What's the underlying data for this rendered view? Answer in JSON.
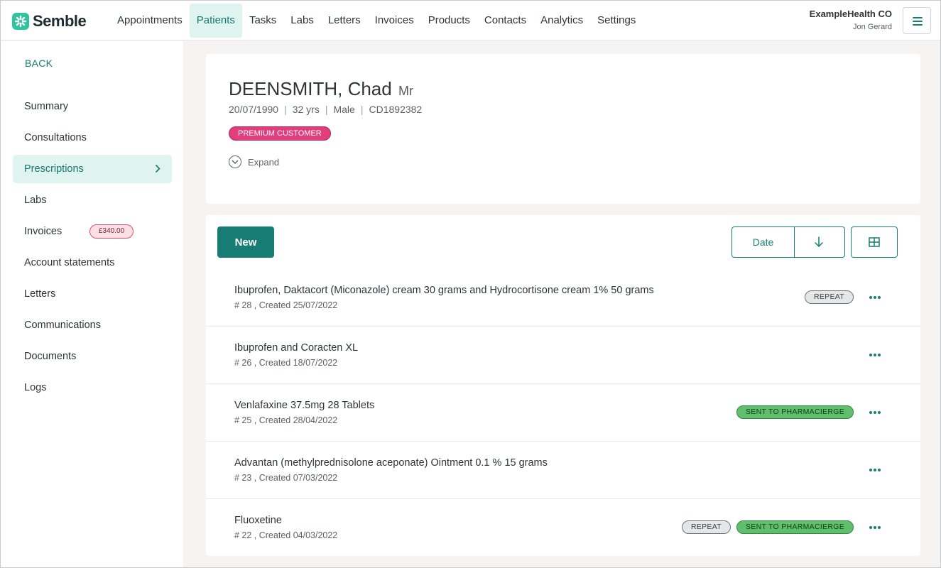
{
  "header": {
    "brand": "Semble",
    "nav": [
      {
        "label": "Appointments",
        "active": false
      },
      {
        "label": "Patients",
        "active": true
      },
      {
        "label": "Tasks",
        "active": false
      },
      {
        "label": "Labs",
        "active": false
      },
      {
        "label": "Letters",
        "active": false
      },
      {
        "label": "Invoices",
        "active": false
      },
      {
        "label": "Products",
        "active": false
      },
      {
        "label": "Contacts",
        "active": false
      },
      {
        "label": "Analytics",
        "active": false
      },
      {
        "label": "Settings",
        "active": false
      }
    ],
    "organisation": "ExampleHealth CO",
    "user": "Jon Gerard",
    "menu_icon": "hamburger-icon"
  },
  "sidebar": {
    "back_label": "BACK",
    "items": [
      {
        "label": "Summary"
      },
      {
        "label": "Consultations"
      },
      {
        "label": "Prescriptions",
        "active": true
      },
      {
        "label": "Labs"
      },
      {
        "label": "Invoices",
        "badge": "£340.00"
      },
      {
        "label": "Account statements"
      },
      {
        "label": "Letters"
      },
      {
        "label": "Communications"
      },
      {
        "label": "Documents"
      },
      {
        "label": "Logs"
      }
    ]
  },
  "patient": {
    "name": "DEENSMITH, Chad",
    "title": "Mr",
    "dob": "20/07/1990",
    "age": "32 yrs",
    "sex": "Male",
    "id": "CD1892382",
    "tag": "PREMIUM CUSTOMER",
    "expand_label": "Expand"
  },
  "toolbar": {
    "new_label": "New",
    "sort_field": "Date",
    "sort_icon": "arrow-down-icon",
    "view_icon": "grid-view-icon"
  },
  "prescriptions": [
    {
      "name": "Ibuprofen, Daktacort (Miconazole) cream 30 grams and Hydrocortisone cream 1% 50 grams",
      "meta": "# 28 , Created 25/07/2022",
      "tags": [
        "REPEAT"
      ]
    },
    {
      "name": "Ibuprofen and Coracten XL",
      "meta": "# 26 , Created 18/07/2022",
      "tags": []
    },
    {
      "name": "Venlafaxine 37.5mg 28 Tablets",
      "meta": "# 25 , Created 28/04/2022",
      "tags": [
        "SENT TO PHARMACIERGE"
      ]
    },
    {
      "name": "Advantan (methylprednisolone aceponate) Ointment 0.1 % 15 grams",
      "meta": "# 23 , Created 07/03/2022",
      "tags": []
    },
    {
      "name": "Fluoxetine",
      "meta": "# 22 , Created 04/03/2022",
      "tags": [
        "REPEAT",
        "SENT TO PHARMACIERGE"
      ]
    }
  ],
  "colors": {
    "accent": "#177d74",
    "brand_mark": "#2ec4a0",
    "premium": "#e23d7d",
    "sent": "#5fbf6c"
  }
}
